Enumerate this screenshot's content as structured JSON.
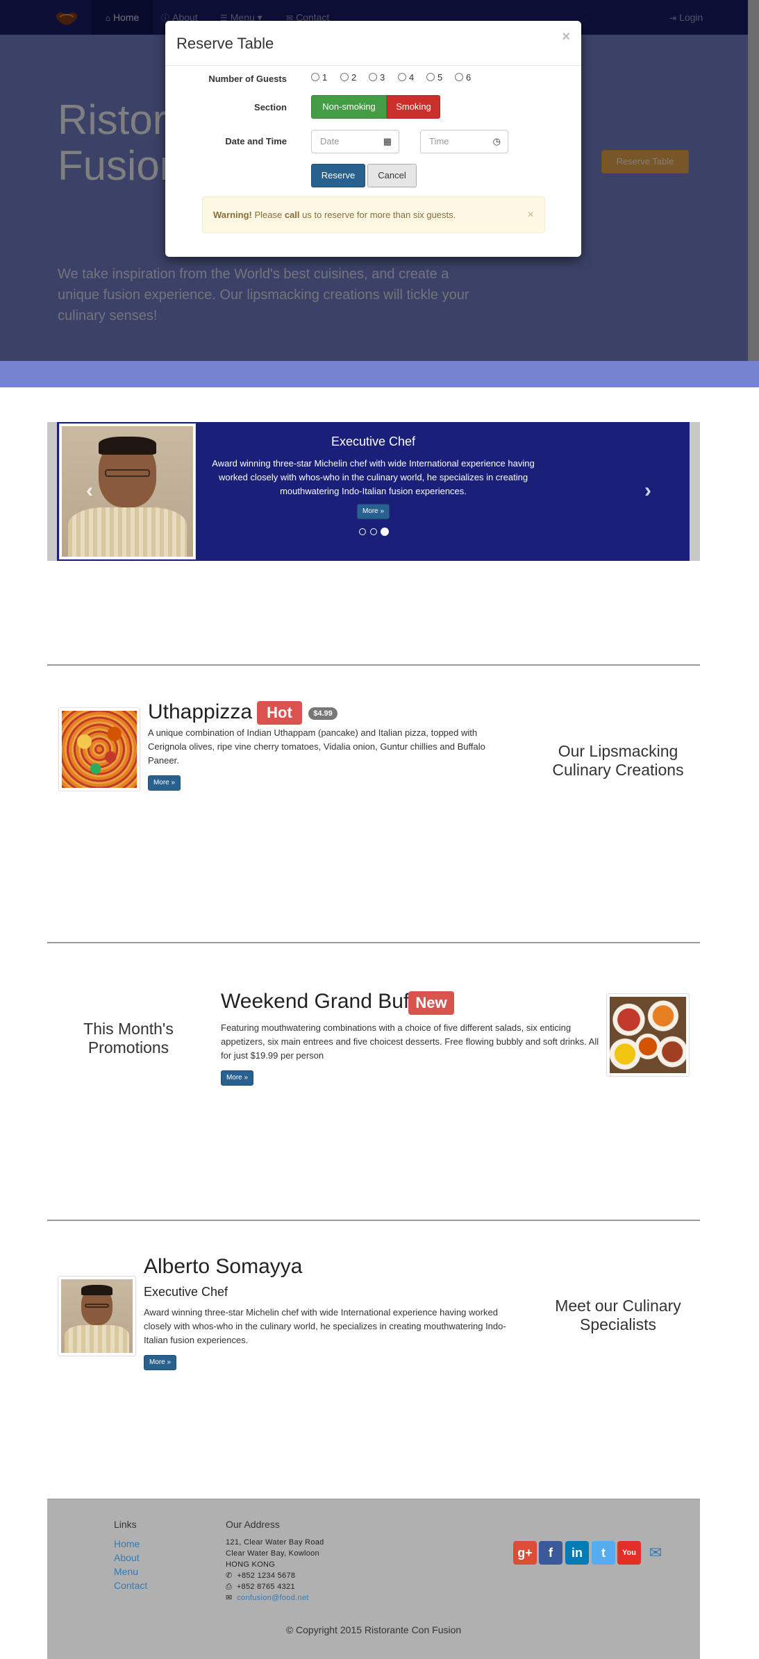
{
  "navbar": {
    "items": [
      {
        "label": "Home",
        "icon": "home-icon"
      },
      {
        "label": "About",
        "icon": "info-icon"
      },
      {
        "label": "Menu",
        "icon": "list-icon"
      },
      {
        "label": "Contact",
        "icon": "envelope-icon"
      }
    ],
    "login": "Login"
  },
  "jumbotron": {
    "title_line1": "Ristorante Con",
    "title_line2": "Fusion",
    "text": "We take inspiration from the World's best cuisines, and create a unique fusion experience. Our lipsmacking creations will tickle your culinary senses!",
    "reserve_button": "Reserve Table"
  },
  "modal": {
    "title": "Reserve Table",
    "close": "×",
    "guests_label": "Number of Guests",
    "guest_options": [
      "1",
      "2",
      "3",
      "4",
      "5",
      "6"
    ],
    "section_label": "Section",
    "section_options": [
      "Non-smoking",
      "Smoking"
    ],
    "datetime_label": "Date and Time",
    "date_placeholder": "Date",
    "time_placeholder": "Time",
    "reserve_button": "Reserve",
    "cancel_button": "Cancel",
    "alert_strong": "Warning!",
    "alert_text1": "Please",
    "alert_call": "call",
    "alert_text2": "us to reserve for more than six guests.",
    "alert_close": "×"
  },
  "carousel": {
    "title": "Executive Chef",
    "text": "Award winning three-star Michelin chef with wide International experience having worked closely with whos-who in the culinary world, he specializes in creating mouthwatering Indo-Italian fusion experiences.",
    "more": "More »",
    "active_slide": 3
  },
  "dish": {
    "name": "Uthappizza",
    "badge": "Hot",
    "price": "$4.99",
    "description": "A unique combination of Indian Uthappam (pancake) and Italian pizza, topped with Cerignola olives, ripe vine cherry tomatoes, Vidalia onion, Guntur chillies and Buffalo Paneer.",
    "more": "More »",
    "section_title": "Our Lipsmacking Culinary Creations"
  },
  "promotion": {
    "section_title": "This Month's Promotions",
    "name": "Weekend Grand Buffet",
    "badge": "New",
    "description": "Featuring mouthwatering combinations with a choice of five different salads, six enticing appetizers, six main entrees and five choicest desserts. Free flowing bubbly and soft drinks. All for just $19.99 per person",
    "more": "More »"
  },
  "leader": {
    "name": "Alberto Somayya",
    "designation": "Executive Chef",
    "description": "Award winning three-star Michelin chef with wide International experience having worked closely with whos-who in the culinary world, he specializes in creating mouthwatering Indo-Italian fusion experiences.",
    "more": "More »",
    "section_title": "Meet our Culinary Specialists"
  },
  "footer": {
    "links_heading": "Links",
    "links": [
      "Home",
      "About",
      "Menu",
      "Contact"
    ],
    "address_heading": "Our Address",
    "address_lines": [
      "121, Clear Water Bay Road",
      "Clear Water Bay, Kowloon",
      "HONG KONG"
    ],
    "phone": "+852 1234 5678",
    "fax": "+852 8765 4321",
    "email": "confusion@food.net",
    "copyright": "© Copyright 2015 Ristorante Con Fusion"
  },
  "colors": {
    "navbar": "#1a1f6e",
    "jumbotron": "#7683ce",
    "reserve_orange": "#f0ad4e",
    "primary": "#286090",
    "danger": "#d9534f",
    "success": "#449d44",
    "footer": "#b0b0b0"
  }
}
